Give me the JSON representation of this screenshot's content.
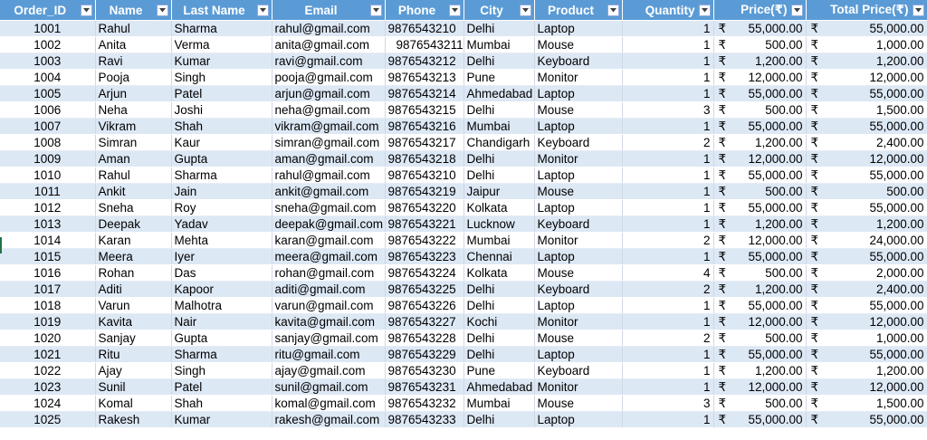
{
  "headers": [
    {
      "key": "order_id",
      "label": "Order_ID"
    },
    {
      "key": "name",
      "label": "Name"
    },
    {
      "key": "last_name",
      "label": "Last Name"
    },
    {
      "key": "email",
      "label": "Email"
    },
    {
      "key": "phone",
      "label": "Phone"
    },
    {
      "key": "city",
      "label": "City"
    },
    {
      "key": "product",
      "label": "Product"
    },
    {
      "key": "quantity",
      "label": "Quantity"
    },
    {
      "key": "price",
      "label": "Price(₹)"
    },
    {
      "key": "total",
      "label": "Total Price(₹)"
    }
  ],
  "currency_symbol": "₹",
  "rows": [
    [
      "1001",
      "Rahul",
      "Sharma",
      "rahul@gmail.com",
      "9876543210",
      "Delhi",
      "Laptop",
      "1",
      "55,000.00",
      "55,000.00"
    ],
    [
      "1002",
      "Anita",
      "Verma",
      "anita@gmail.com",
      "9876543211",
      "Mumbai",
      "Mouse",
      "1",
      "500.00",
      "1,000.00"
    ],
    [
      "1003",
      "Ravi",
      "Kumar",
      "ravi@gmail.com",
      "9876543212",
      "Delhi",
      "Keyboard",
      "1",
      "1,200.00",
      "1,200.00"
    ],
    [
      "1004",
      "Pooja",
      "Singh",
      "pooja@gmail.com",
      "9876543213",
      "Pune",
      "Monitor",
      "1",
      "12,000.00",
      "12,000.00"
    ],
    [
      "1005",
      "Arjun",
      "Patel",
      "arjun@gmail.com",
      "9876543214",
      "Ahmedabad",
      "Laptop",
      "1",
      "55,000.00",
      "55,000.00"
    ],
    [
      "1006",
      "Neha",
      "Joshi",
      "neha@gmail.com",
      "9876543215",
      "Delhi",
      "Mouse",
      "3",
      "500.00",
      "1,500.00"
    ],
    [
      "1007",
      "Vikram",
      "Shah",
      "vikram@gmail.com",
      "9876543216",
      "Mumbai",
      "Laptop",
      "1",
      "55,000.00",
      "55,000.00"
    ],
    [
      "1008",
      "Simran",
      "Kaur",
      "simran@gmail.com",
      "9876543217",
      "Chandigarh",
      "Keyboard",
      "2",
      "1,200.00",
      "2,400.00"
    ],
    [
      "1009",
      "Aman",
      "Gupta",
      "aman@gmail.com",
      "9876543218",
      "Delhi",
      "Monitor",
      "1",
      "12,000.00",
      "12,000.00"
    ],
    [
      "1010",
      "Rahul",
      "Sharma",
      "rahul@gmail.com",
      "9876543210",
      "Delhi",
      "Laptop",
      "1",
      "55,000.00",
      "55,000.00"
    ],
    [
      "1011",
      "Ankit",
      "Jain",
      "ankit@gmail.com",
      "9876543219",
      "Jaipur",
      "Mouse",
      "1",
      "500.00",
      "500.00"
    ],
    [
      "1012",
      "Sneha",
      "Roy",
      "sneha@gmail.com",
      "9876543220",
      "Kolkata",
      "Laptop",
      "1",
      "55,000.00",
      "55,000.00"
    ],
    [
      "1013",
      "Deepak",
      "Yadav",
      "deepak@gmail.com",
      "9876543221",
      "Lucknow",
      "Keyboard",
      "1",
      "1,200.00",
      "1,200.00"
    ],
    [
      "1014",
      "Karan",
      "Mehta",
      "karan@gmail.com",
      "9876543222",
      "Mumbai",
      "Monitor",
      "2",
      "12,000.00",
      "24,000.00"
    ],
    [
      "1015",
      "Meera",
      "Iyer",
      "meera@gmail.com",
      "9876543223",
      "Chennai",
      "Laptop",
      "1",
      "55,000.00",
      "55,000.00"
    ],
    [
      "1016",
      "Rohan",
      "Das",
      "rohan@gmail.com",
      "9876543224",
      "Kolkata",
      "Mouse",
      "4",
      "500.00",
      "2,000.00"
    ],
    [
      "1017",
      "Aditi",
      "Kapoor",
      "aditi@gmail.com",
      "9876543225",
      "Delhi",
      "Keyboard",
      "2",
      "1,200.00",
      "2,400.00"
    ],
    [
      "1018",
      "Varun",
      "Malhotra",
      "varun@gmail.com",
      "9876543226",
      "Delhi",
      "Laptop",
      "1",
      "55,000.00",
      "55,000.00"
    ],
    [
      "1019",
      "Kavita",
      "Nair",
      "kavita@gmail.com",
      "9876543227",
      "Kochi",
      "Monitor",
      "1",
      "12,000.00",
      "12,000.00"
    ],
    [
      "1020",
      "Sanjay",
      "Gupta",
      "sanjay@gmail.com",
      "9876543228",
      "Delhi",
      "Mouse",
      "2",
      "500.00",
      "1,000.00"
    ],
    [
      "1021",
      "Ritu",
      "Sharma",
      "ritu@gmail.com",
      "9876543229",
      "Delhi",
      "Laptop",
      "1",
      "55,000.00",
      "55,000.00"
    ],
    [
      "1022",
      "Ajay",
      "Singh",
      "ajay@gmail.com",
      "9876543230",
      "Pune",
      "Keyboard",
      "1",
      "1,200.00",
      "1,200.00"
    ],
    [
      "1023",
      "Sunil",
      "Patel",
      "sunil@gmail.com",
      "9876543231",
      "Ahmedabad",
      "Monitor",
      "1",
      "12,000.00",
      "12,000.00"
    ],
    [
      "1024",
      "Komal",
      "Shah",
      "komal@gmail.com",
      "9876543232",
      "Mumbai",
      "Mouse",
      "3",
      "500.00",
      "1,500.00"
    ],
    [
      "1025",
      "Rakesh",
      "Kumar",
      "rakesh@gmail.com",
      "9876543233",
      "Delhi",
      "Laptop",
      "1",
      "55,000.00",
      "55,000.00"
    ]
  ],
  "icons": {
    "filter": "filter-dropdown-icon"
  },
  "colors": {
    "header_bg": "#5b9bd5",
    "band_bg": "#dde8f5",
    "header_text": "#ffffff"
  }
}
